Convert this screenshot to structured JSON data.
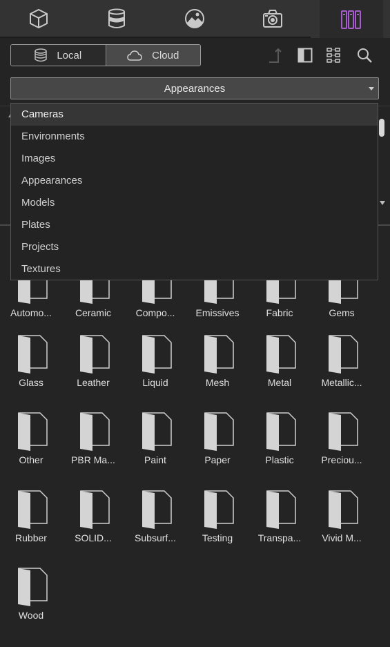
{
  "top_tabs": [
    {
      "icon": "cube-icon"
    },
    {
      "icon": "database-icon"
    },
    {
      "icon": "image-icon"
    },
    {
      "icon": "camera-icon"
    },
    {
      "icon": "library-icon",
      "active": true
    }
  ],
  "source_toggle": {
    "local_label": "Local",
    "cloud_label": "Cloud",
    "selected": "Cloud"
  },
  "toolbar_icons": [
    "upload-icon",
    "split-view-icon",
    "tree-view-icon",
    "search-icon"
  ],
  "category_select": {
    "value": "Appearances"
  },
  "dropdown_options": [
    "Cameras",
    "Environments",
    "Images",
    "Appearances",
    "Models",
    "Plates",
    "Projects",
    "Textures"
  ],
  "dropdown_highlighted": "Cameras",
  "folders": [
    "Automo...",
    "Ceramic",
    "Compo...",
    "Emissives",
    "Fabric",
    "Gems",
    "Glass",
    "Leather",
    "Liquid",
    "Mesh",
    "Metal",
    "Metallic...",
    "Other",
    "PBR Ma...",
    "Paint",
    "Paper",
    "Plastic",
    "Preciou...",
    "Rubber",
    "SOLID...",
    "Subsurf...",
    "Testing",
    "Transpa...",
    "Vivid M...",
    "Wood"
  ],
  "colors": {
    "accent": "#a45fc8",
    "background": "#242424",
    "header": "#333333"
  }
}
